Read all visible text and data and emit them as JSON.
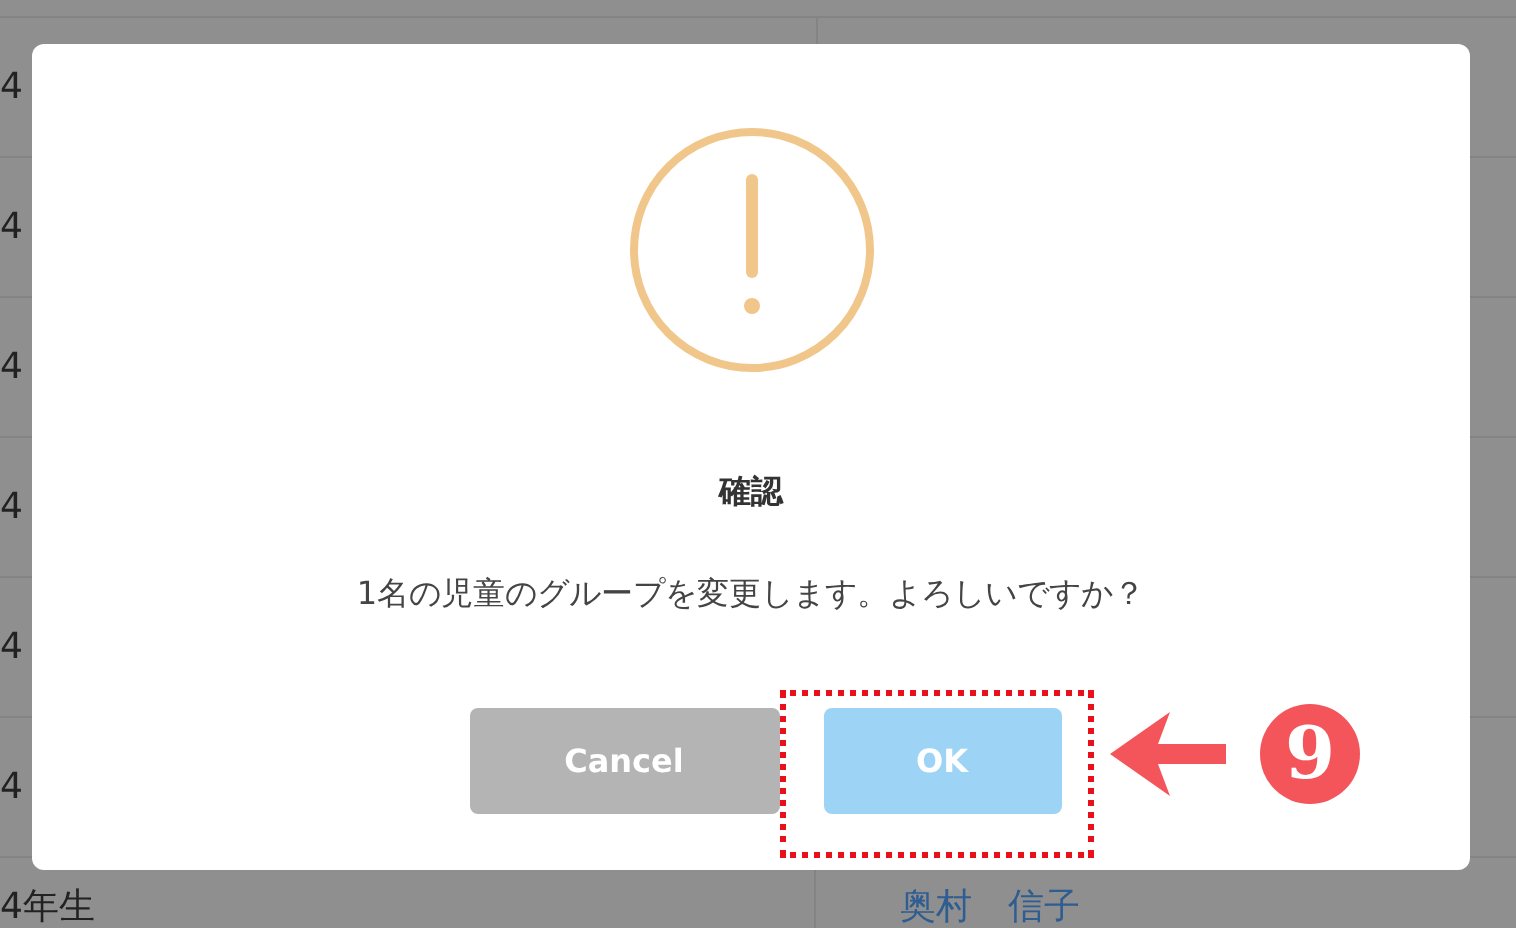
{
  "background_table": {
    "rows": [
      {
        "column_1": "4"
      },
      {
        "column_1": "4"
      },
      {
        "column_1": "4"
      },
      {
        "column_1": "4"
      },
      {
        "column_1": "4"
      },
      {
        "column_1": "4"
      },
      {
        "column_1": "4年生",
        "column_2": "奥村　信子"
      }
    ]
  },
  "dialog": {
    "title": "確認",
    "message": "1名の児童のグループを変更します。よろしいですか？",
    "buttons": [
      {
        "label": "Cancel",
        "kind": "cancel"
      },
      {
        "label": "OK",
        "kind": "confirm"
      }
    ]
  },
  "annotation": {
    "step": "9"
  }
}
